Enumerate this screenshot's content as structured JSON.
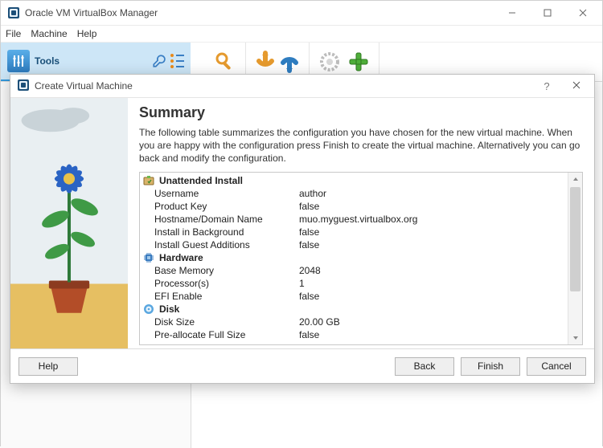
{
  "window": {
    "title": "Oracle VM VirtualBox Manager",
    "menu": {
      "file": "File",
      "machine": "Machine",
      "help": "Help"
    },
    "tools_label": "Tools"
  },
  "dialog": {
    "title": "Create Virtual Machine",
    "heading": "Summary",
    "description": "The following table summarizes the configuration you have chosen for the new virtual machine. When you are happy with the configuration press Finish to create the virtual machine. Alternatively you can go back and modify the configuration.",
    "sections": {
      "unattended": {
        "title": "Unattended Install",
        "rows": {
          "username": {
            "k": "Username",
            "v": "author"
          },
          "productkey": {
            "k": "Product Key",
            "v": "false"
          },
          "hostname": {
            "k": "Hostname/Domain Name",
            "v": "muo.myguest.virtualbox.org"
          },
          "bg": {
            "k": "Install in Background",
            "v": "false"
          },
          "ga": {
            "k": "Install Guest Additions",
            "v": "false"
          }
        }
      },
      "hardware": {
        "title": "Hardware",
        "rows": {
          "mem": {
            "k": "Base Memory",
            "v": "2048"
          },
          "cpu": {
            "k": "Processor(s)",
            "v": "1"
          },
          "efi": {
            "k": "EFI Enable",
            "v": "false"
          }
        }
      },
      "disk": {
        "title": "Disk",
        "rows": {
          "size": {
            "k": "Disk Size",
            "v": "20.00 GB"
          },
          "pre": {
            "k": "Pre-allocate Full Size",
            "v": "false"
          }
        }
      }
    },
    "buttons": {
      "help": "Help",
      "back": "Back",
      "finish": "Finish",
      "cancel": "Cancel"
    }
  }
}
